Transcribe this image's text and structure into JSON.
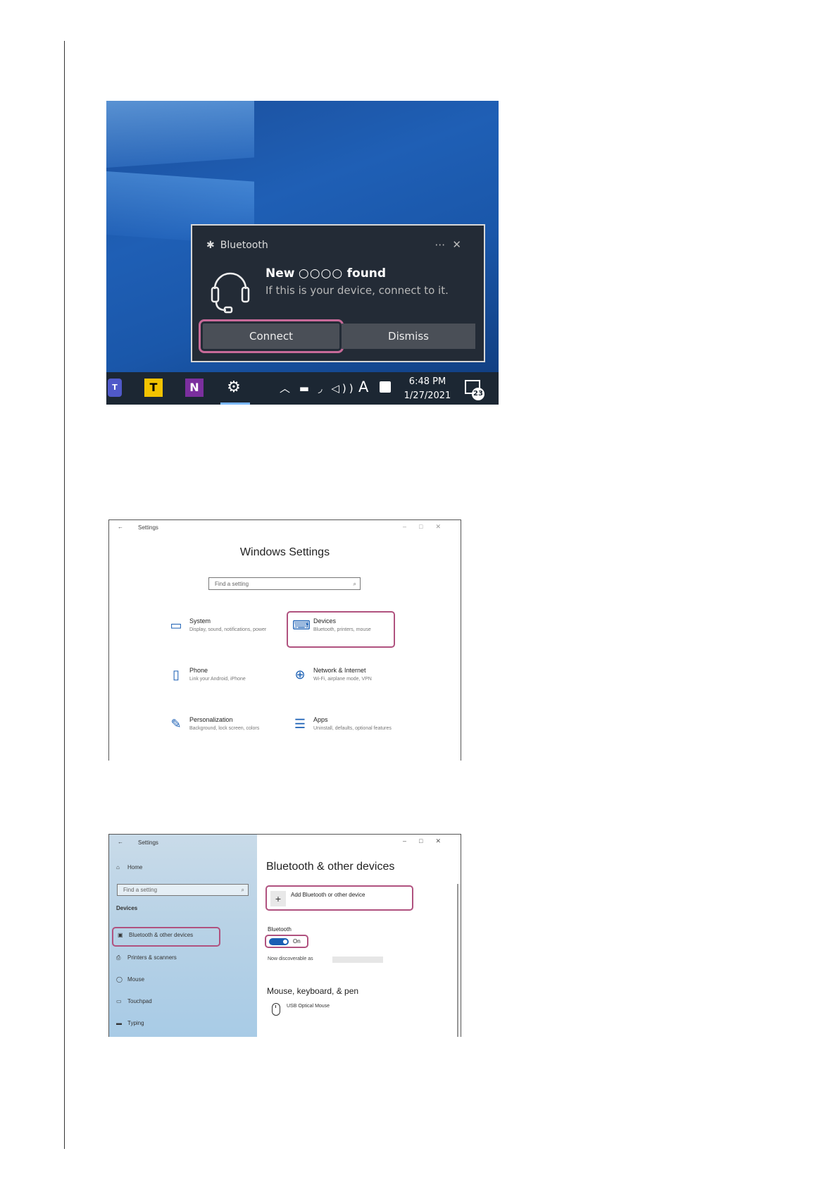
{
  "toast": {
    "app_name": "Bluetooth",
    "more_icon": "more-icon",
    "close_icon": "close-icon",
    "title_prefix": "New",
    "title_placeholder": "○○○○",
    "title_suffix": "found",
    "subtitle": "If this is your device, connect to it.",
    "connect_label": "Connect",
    "dismiss_label": "Dismiss"
  },
  "taskbar": {
    "app_t_label": "T",
    "app_n_label": "N",
    "tray_font_label": "A",
    "time": "6:48 PM",
    "date": "1/27/2021",
    "notification_count": "23"
  },
  "settings_home": {
    "window_title": "Settings",
    "heading": "Windows Settings",
    "search_placeholder": "Find a setting",
    "categories": [
      {
        "name": "System",
        "desc": "Display, sound, notifications, power",
        "icon": "laptop-icon"
      },
      {
        "name": "Devices",
        "desc": "Bluetooth, printers, mouse",
        "icon": "devices-icon"
      },
      {
        "name": "Phone",
        "desc": "Link your Android, iPhone",
        "icon": "phone-icon"
      },
      {
        "name": "Network & Internet",
        "desc": "Wi-Fi, airplane mode, VPN",
        "icon": "globe-icon"
      },
      {
        "name": "Personalization",
        "desc": "Background, lock screen, colors",
        "icon": "personalization-icon"
      },
      {
        "name": "Apps",
        "desc": "Uninstall, defaults, optional features",
        "icon": "apps-icon"
      }
    ]
  },
  "bt_settings": {
    "window_title": "Settings",
    "home_label": "Home",
    "search_placeholder": "Find a setting",
    "section_label": "Devices",
    "nav": [
      {
        "label": "Bluetooth & other devices",
        "icon": "bluetooth-devices-icon"
      },
      {
        "label": "Printers & scanners",
        "icon": "printer-icon"
      },
      {
        "label": "Mouse",
        "icon": "mouse-icon"
      },
      {
        "label": "Touchpad",
        "icon": "touchpad-icon"
      },
      {
        "label": "Typing",
        "icon": "keyboard-icon"
      }
    ],
    "page_title": "Bluetooth & other devices",
    "add_device_label": "Add Bluetooth or other device",
    "bluetooth_label": "Bluetooth",
    "toggle_state": "On",
    "discoverable_text": "Now discoverable as",
    "section_mouse": "Mouse, keyboard, & pen",
    "device_name": "USB Optical Mouse"
  },
  "colors": {
    "highlight": "#b0527f",
    "accent": "#1a5fb4",
    "toast_bg": "#232b36"
  }
}
